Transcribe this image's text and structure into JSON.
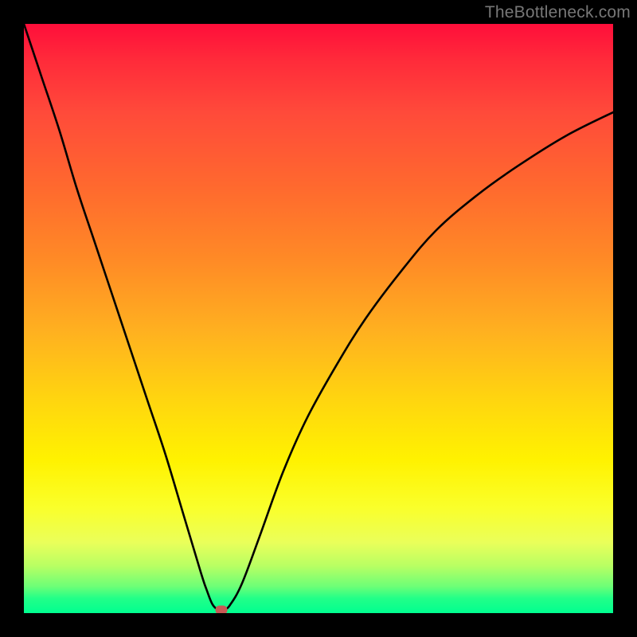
{
  "watermark": "TheBottleneck.com",
  "chart_data": {
    "type": "line",
    "title": "",
    "xlabel": "",
    "ylabel": "",
    "xlim": [
      0,
      100
    ],
    "ylim": [
      0,
      100
    ],
    "grid": false,
    "series": [
      {
        "name": "bottleneck-curve",
        "x": [
          0,
          3,
          6,
          9,
          12,
          15,
          18,
          21,
          24,
          27,
          30,
          31,
          32,
          33,
          34,
          35,
          37,
          40,
          44,
          48,
          53,
          58,
          64,
          70,
          77,
          84,
          92,
          100
        ],
        "y": [
          100,
          91,
          82,
          72,
          63,
          54,
          45,
          36,
          27,
          17,
          7,
          4,
          1.5,
          0.6,
          0.6,
          1.4,
          5,
          13,
          24,
          33,
          42,
          50,
          58,
          65,
          71,
          76,
          81,
          85
        ]
      }
    ],
    "marker": {
      "x": 33.5,
      "y": 0.6,
      "color": "#c85a55"
    },
    "colors": {
      "curve": "#000000",
      "gradient_top": "#ff0e3a",
      "gradient_bottom": "#00ff90"
    }
  }
}
